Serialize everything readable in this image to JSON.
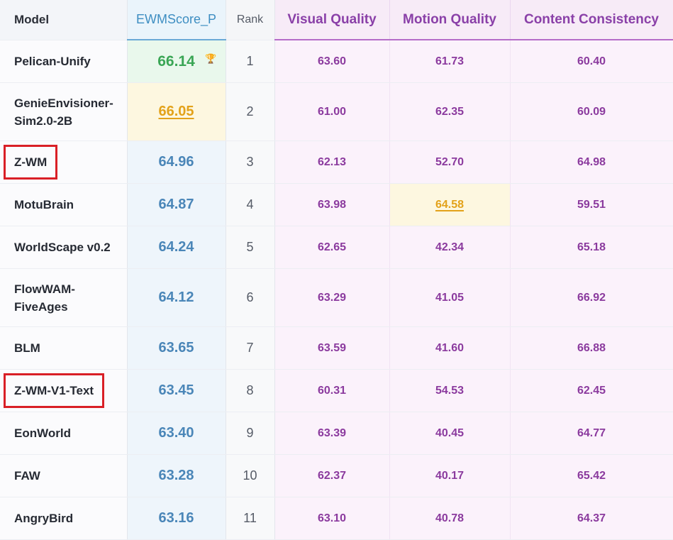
{
  "headers": {
    "model": "Model",
    "ewmscore": "EWMScore_P",
    "rank": "Rank",
    "visual": "Visual Quality",
    "motion": "Motion Quality",
    "content": "Content Consistency"
  },
  "rows": [
    {
      "model": "Pelican-Unify",
      "ewmscore": "66.14",
      "rank": "1",
      "visual": "63.60",
      "motion": "61.73",
      "content": "60.40"
    },
    {
      "model": "GenieEnvisioner-Sim2.0-2B",
      "ewmscore": "66.05",
      "rank": "2",
      "visual": "61.00",
      "motion": "62.35",
      "content": "60.09"
    },
    {
      "model": "Z-WM",
      "ewmscore": "64.96",
      "rank": "3",
      "visual": "62.13",
      "motion": "52.70",
      "content": "64.98"
    },
    {
      "model": "MotuBrain",
      "ewmscore": "64.87",
      "rank": "4",
      "visual": "63.98",
      "motion": "64.58",
      "content": "59.51"
    },
    {
      "model": "WorldScape v0.2",
      "ewmscore": "64.24",
      "rank": "5",
      "visual": "62.65",
      "motion": "42.34",
      "content": "65.18"
    },
    {
      "model": "FlowWAM-FiveAges",
      "ewmscore": "64.12",
      "rank": "6",
      "visual": "63.29",
      "motion": "41.05",
      "content": "66.92"
    },
    {
      "model": "BLM",
      "ewmscore": "63.65",
      "rank": "7",
      "visual": "63.59",
      "motion": "41.60",
      "content": "66.88"
    },
    {
      "model": "Z-WM-V1-Text",
      "ewmscore": "63.45",
      "rank": "8",
      "visual": "60.31",
      "motion": "54.53",
      "content": "62.45"
    },
    {
      "model": "EonWorld",
      "ewmscore": "63.40",
      "rank": "9",
      "visual": "63.39",
      "motion": "40.45",
      "content": "64.77"
    },
    {
      "model": "FAW",
      "ewmscore": "63.28",
      "rank": "10",
      "visual": "62.37",
      "motion": "40.17",
      "content": "65.42"
    },
    {
      "model": "AngryBird",
      "ewmscore": "63.16",
      "rank": "11",
      "visual": "63.10",
      "motion": "40.78",
      "content": "64.37"
    }
  ],
  "icons": {
    "top_score": "trophy-icon"
  },
  "colors": {
    "highlight_box": "#d91f26",
    "best_score": "#3aa655",
    "second_best": "#e3a21a",
    "score_blue": "#4a86b8",
    "metric_purple": "#8b3a9e"
  }
}
